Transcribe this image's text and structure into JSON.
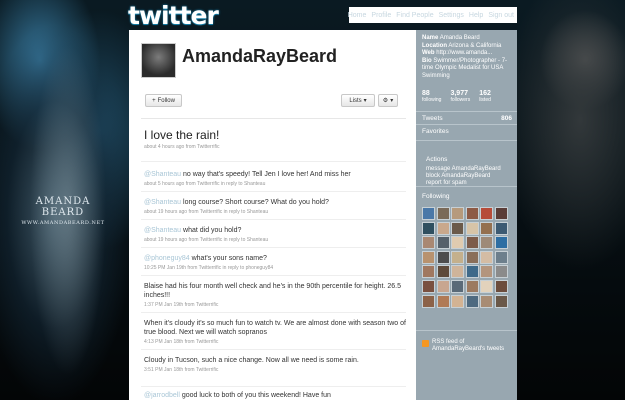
{
  "background": {
    "brand_name": "AMANDA BEARD",
    "brand_url": "WWW.AMANDABEARD.NET"
  },
  "header": {
    "logo": "twitter",
    "nav": [
      "Home",
      "Profile",
      "Find People",
      "Settings",
      "Help",
      "Sign out"
    ]
  },
  "profile": {
    "screen_name": "AmandaRayBeard",
    "follow_label": "Follow",
    "lists_label": "Lists",
    "gear_icon": "gear-icon"
  },
  "tweets": [
    {
      "text": "I love the rain!",
      "meta": "about 4 hours ago from Twitterrific"
    },
    {
      "mention": "@Shanteau",
      "text": " no way that's speedy! Tell Jen I love her! And miss her",
      "meta": "about 5 hours ago from Twitterrific in reply to Shanteau"
    },
    {
      "mention": "@Shanteau",
      "text": " long course? Short course? What do you hold?",
      "meta": "about 19 hours ago from Twitterrific in reply to Shanteau"
    },
    {
      "mention": "@Shanteau",
      "text": " what did you hold?",
      "meta": "about 19 hours ago from Twitterrific in reply to Shanteau"
    },
    {
      "mention": "@phoneguy84",
      "text": " what's your sons name?",
      "meta": "10:25 PM Jan 19th from Twitterrific in reply to phoneguy84"
    },
    {
      "text": "Blaise had his four month well check and he's in the 90th percentile for height. 26.5 inches!!!",
      "meta": "1:37 PM Jan 19th from Twitterrific"
    },
    {
      "text": "When it's cloudy it's so much fun to watch tv. We are almost done with season two of true blood. Next we will watch sopranos",
      "meta": "4:13 PM Jan 18th from Twitterrific"
    },
    {
      "text": "Cloudy in Tucson, such a nice change. Now all we need is some rain.",
      "meta": "3:51 PM Jan 18th from Twitterrific"
    },
    {
      "mention": "@jarrodbell",
      "text": " good luck to both of you this weekend! Have fun",
      "meta": ""
    }
  ],
  "sidebar": {
    "name_label": "Name",
    "name": "Amanda Beard",
    "location_label": "Location",
    "location": "Arizona & California",
    "web_label": "Web",
    "web": "http://www.amanda...",
    "bio_label": "Bio",
    "bio": "Swimmer/Photographer - 7-time Olympic Medalist for USA Swimming",
    "stats": [
      {
        "num": "88",
        "label": "following"
      },
      {
        "num": "3,977",
        "label": "followers"
      },
      {
        "num": "162",
        "label": "listed"
      }
    ],
    "tweets_label": "Tweets",
    "tweets_count": "806",
    "favorites_label": "Favorites",
    "actions_label": "Actions",
    "actions_message": "message AmandaRayBeard",
    "actions_block": "block AmandaRayBeard",
    "actions_report": "report for spam",
    "following_label": "Following",
    "rss_text": "RSS feed of AmandaRayBeard's tweets"
  }
}
